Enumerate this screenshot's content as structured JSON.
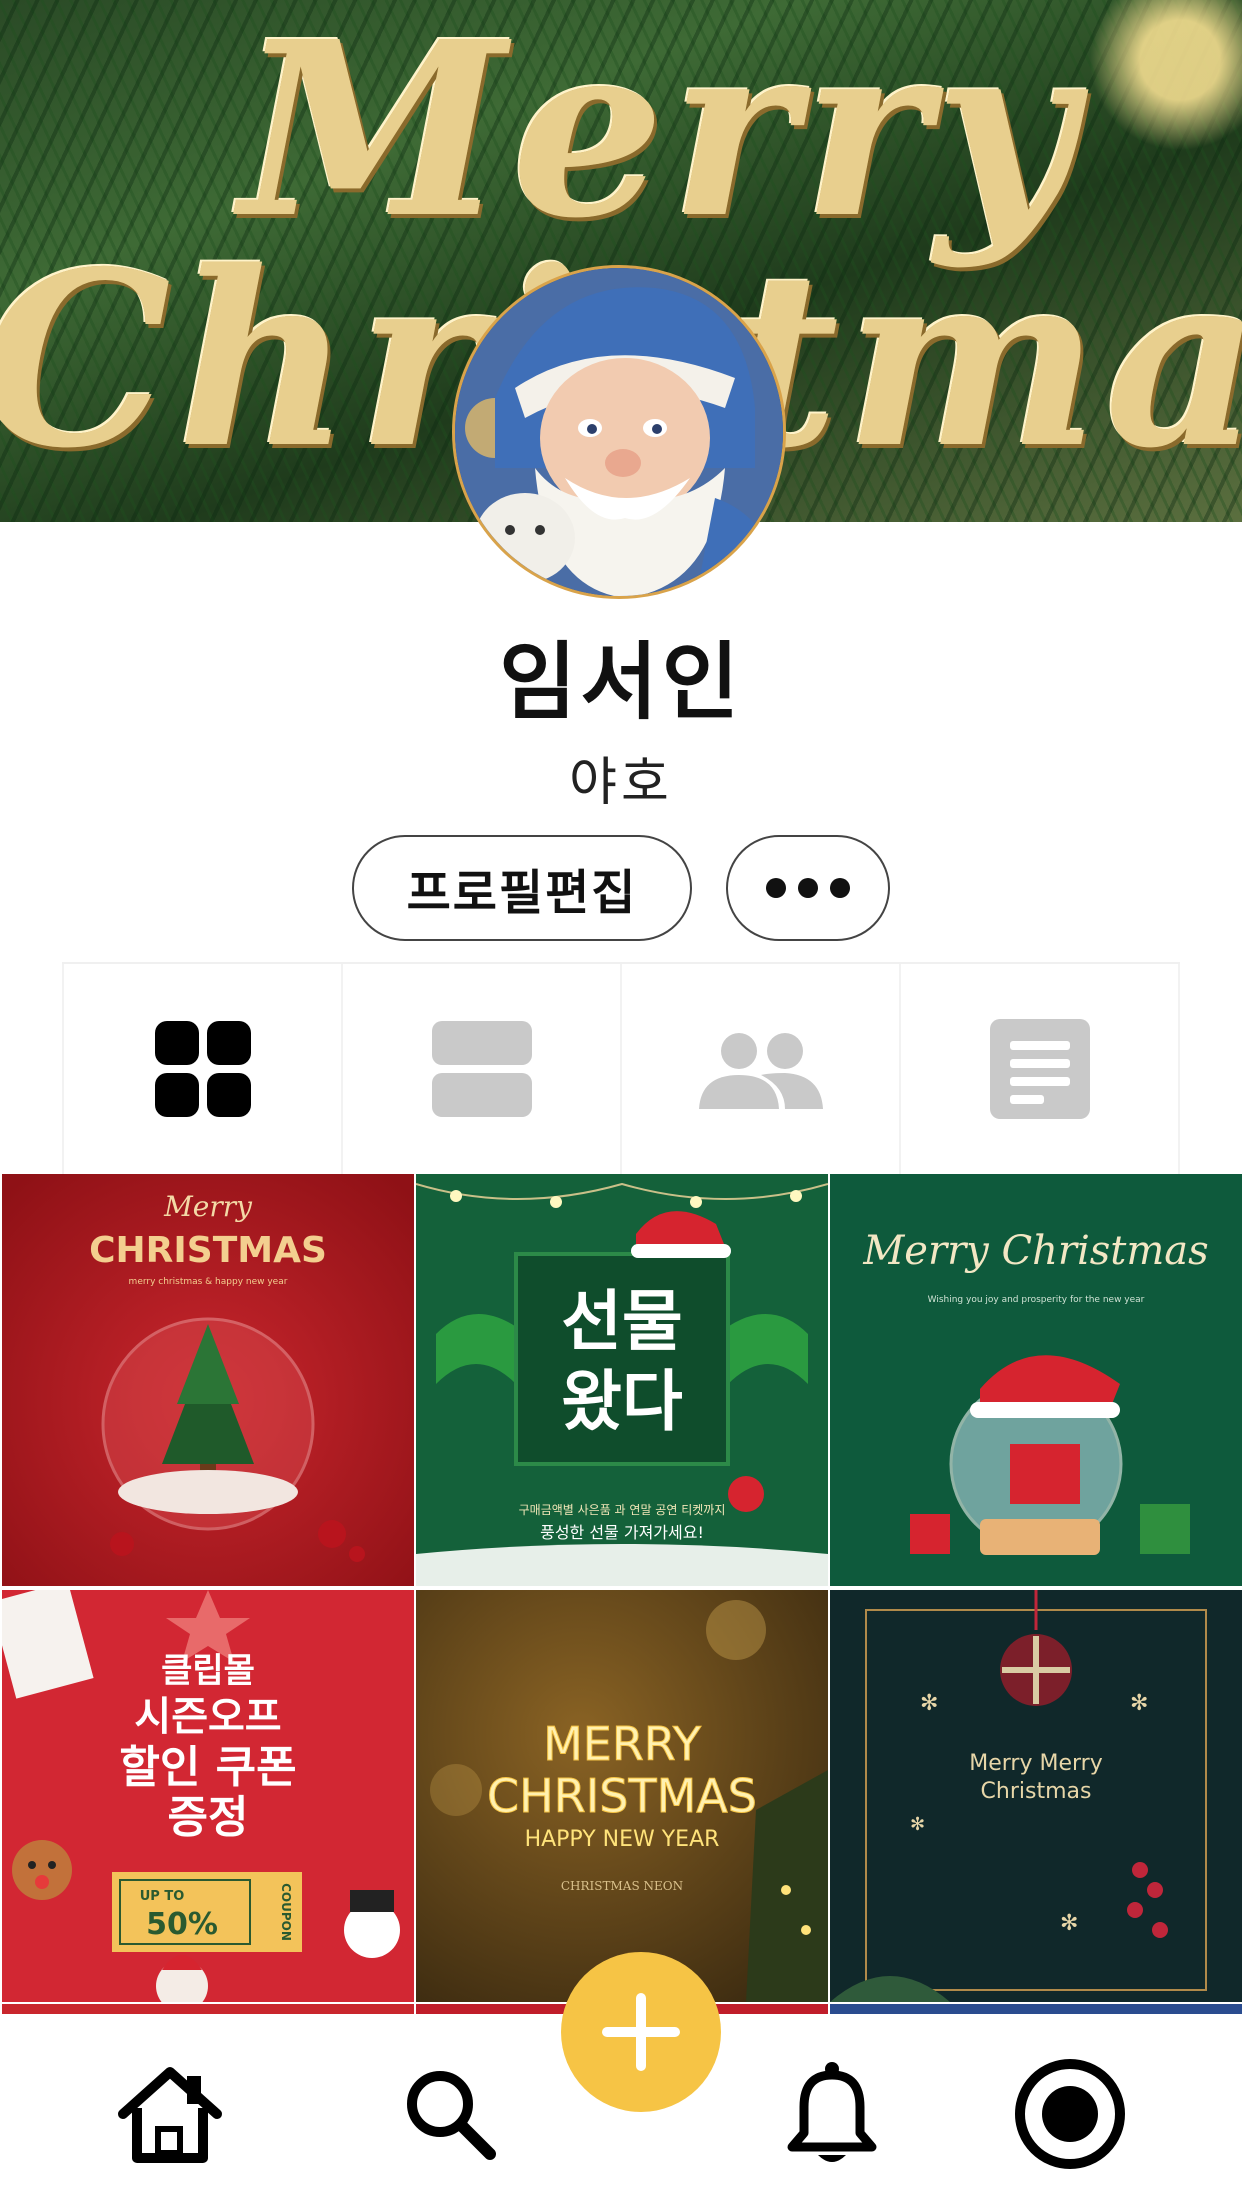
{
  "cover": {
    "line1": "Merry",
    "line2": "Christmas"
  },
  "profile": {
    "name": "임서인",
    "bio": "야호",
    "edit_button": "프로필편집"
  },
  "tabs": [
    {
      "icon": "grid-icon",
      "active": true
    },
    {
      "icon": "list-icon",
      "active": false
    },
    {
      "icon": "people-icon",
      "active": false
    },
    {
      "icon": "document-icon",
      "active": false
    }
  ],
  "posts": [
    {
      "title_script": "Merry",
      "title": "CHRISTMAS",
      "small": "merry christmas & happy new year"
    },
    {
      "line1": "선물",
      "line2": "왔다",
      "caption1": "구매금액별 사은품 과 연말 공연 티켓까지",
      "caption2": "풍성한 선물 가져가세요!"
    },
    {
      "title": "Merry Christmas",
      "small": "Wishing you joy and prosperity for the new year"
    },
    {
      "line1": "클립몰",
      "line2": "시즌오프",
      "line3": "할인 쿠폰",
      "line4": "증정",
      "coupon_small": "UP TO",
      "coupon_big": "50%",
      "coupon_word": "COUPON"
    },
    {
      "line1": "MERRY",
      "line2": "CHRISTMAS",
      "line3": "HAPPY NEW YEAR",
      "small": "CHRISTMAS NEON"
    },
    {
      "line1": "Merry Merry",
      "line2": "Christmas"
    }
  ],
  "colors": {
    "accent": "#f6c445",
    "active_icon": "#000000",
    "inactive_icon": "#c9c9c9"
  },
  "nav": [
    "home-icon",
    "search-icon",
    "bell-icon",
    "profile-circle-icon"
  ]
}
